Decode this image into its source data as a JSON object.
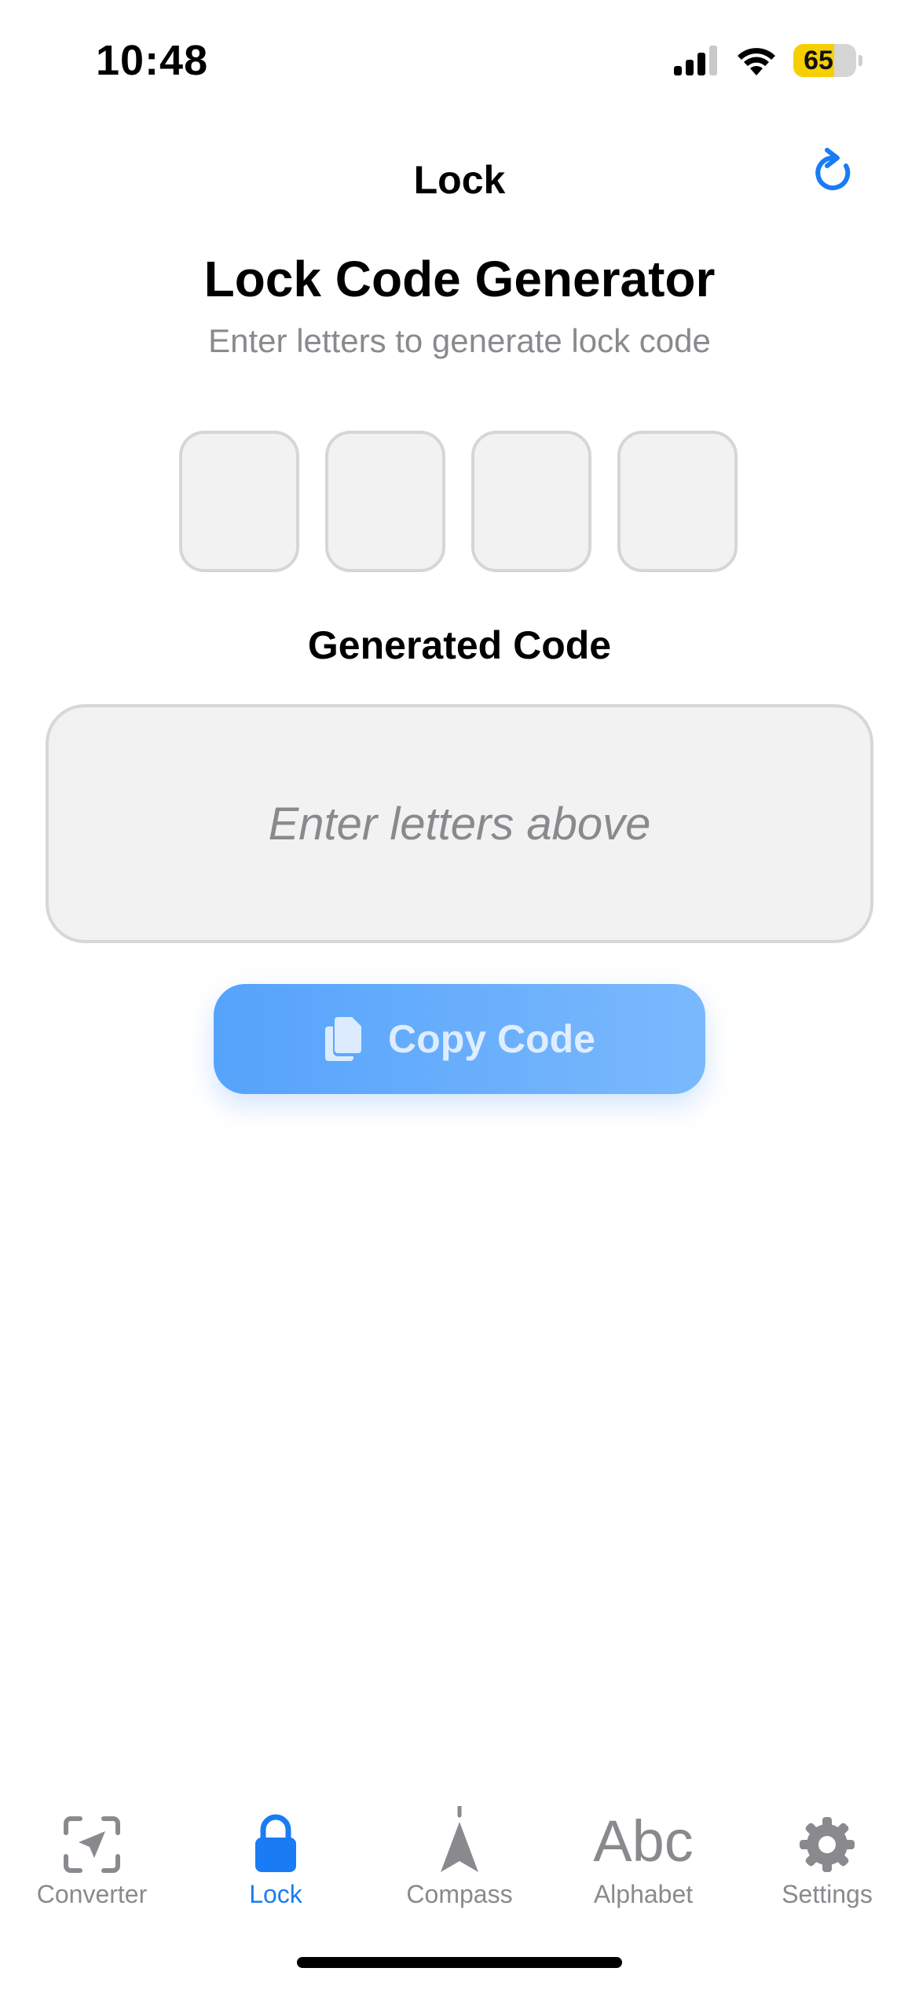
{
  "status_bar": {
    "time": "10:48",
    "battery": "65",
    "battery_level": 0.65,
    "battery_color": "#f6cf00"
  },
  "nav": {
    "title": "Lock",
    "refresh_icon": "refresh-icon"
  },
  "header": {
    "title": "Lock Code Generator",
    "subtitle": "Enter letters to generate lock code"
  },
  "letter_inputs": [
    {
      "value": "",
      "placeholder": ""
    },
    {
      "value": "",
      "placeholder": ""
    },
    {
      "value": "",
      "placeholder": ""
    },
    {
      "value": "",
      "placeholder": ""
    }
  ],
  "generated": {
    "label": "Generated Code",
    "placeholder": "Enter letters above"
  },
  "copy_button": {
    "label": "Copy Code",
    "icon": "copy-icon",
    "color": "#55a3fb"
  },
  "tabs": [
    {
      "label": "Converter",
      "icon": "converter-icon",
      "active": false
    },
    {
      "label": "Lock",
      "icon": "lock-icon",
      "active": true
    },
    {
      "label": "Compass",
      "icon": "compass-icon",
      "active": false
    },
    {
      "label": "Alphabet",
      "icon": "alphabet-icon",
      "glyph": "Abc",
      "active": false
    },
    {
      "label": "Settings",
      "icon": "gear-icon",
      "active": false
    }
  ],
  "colors": {
    "accent": "#1a7cf5",
    "inactive": "#8a8a8e",
    "field_bg": "#f2f2f2",
    "field_border": "#d6d6d6"
  }
}
